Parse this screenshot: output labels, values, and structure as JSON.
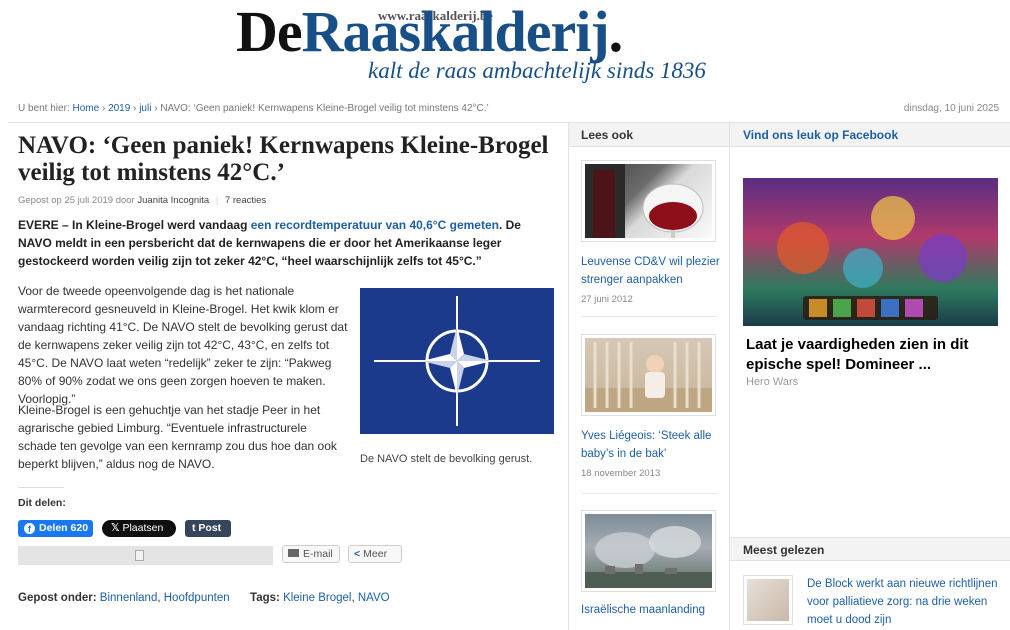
{
  "header": {
    "logo_url": "www.raaskalderij.be",
    "logo_de": "De",
    "logo_name": "Raaskalderij",
    "logo_dot": ".",
    "slogan": "kalt de raas ambachtelijk sinds 1836"
  },
  "breadcrumb": {
    "prefix": "U bent hier:",
    "items": [
      "Home",
      "2019",
      "juli"
    ],
    "current": "NAVO: ‘Geen paniek! Kernwapens Kleine-Brogel veilig tot minstens 42°C.’",
    "date": "dinsdag, 10 juni 2025"
  },
  "article": {
    "title": "NAVO: ‘Geen paniek! Kernwapens Kleine-Brogel veilig tot minstens 42°C.’",
    "posted_prefix": "Gepost op 25 juli 2019 door",
    "author": "Juanita Incognita",
    "comments": "7 reacties",
    "lead_before": "EVERE – In Kleine-Brogel werd vandaag ",
    "lead_link": "een recordtemperatuur van 40,6°C gemeten",
    "lead_after": ". De NAVO meldt in een persbericht dat de kernwapens die er door het Amerikaanse leger gestockeerd worden veilig zijn tot zeker 42°C, “heel waarschijnlijk zelfs tot 45°C.”",
    "para1": "Voor de tweede opeenvolgende dag is het nationale warmterecord gesneuveld in Kleine-Brogel. Het kwik klom er vandaag richting 41°C. De NAVO stelt de bevolking gerust dat de kernwapens zeker veilig zijn tot 42°C, 43°C, en zelfs tot 45°C. De NAVO laat weten “redelijk” zeker te zijn: “Pakweg 80% of 90% zodat we ons geen zorgen hoeven te maken. Voorlopig.”",
    "para2": "Kleine-Brogel is een gehuchtje van het stadje Peer in het agrarische gebied Limburg. “Eventuele infrastructurele schade ten gevolge van een kernramp zou dus hoe dan ook beperkt blijven,” aldus nog de NAVO.",
    "image_caption": "De NAVO stelt de bevolking gerust."
  },
  "share": {
    "label": "Dit delen:",
    "facebook": "Delen 620",
    "x": "Plaatsen",
    "tumblr": "Post",
    "email": "E-mail",
    "more": "Meer"
  },
  "footer_meta": {
    "posted_label": "Gepost onder:",
    "categories": [
      "Binnenland",
      "Hoofdpunten"
    ],
    "tags_label": "Tags:",
    "tags": [
      "Kleine Brogel",
      "NAVO"
    ]
  },
  "lees_ook": {
    "heading": "Lees ook",
    "items": [
      {
        "title": "Leuvense CD&V wil plezier strenger aanpakken",
        "date": "27 juni 2012"
      },
      {
        "title": "Yves Liégeois: ‘Steek alle baby’s in de bak’",
        "date": "18 november 2013"
      },
      {
        "title": "Israëlische maanlanding",
        "date": ""
      }
    ]
  },
  "facebook_col": {
    "heading": "Vind ons leuk op Facebook",
    "ad_title": "Laat je vaardigheden zien in dit epische spel! Domineer ...",
    "ad_source": "Hero Wars"
  },
  "meest_gelezen": {
    "heading": "Meest gelezen",
    "items": [
      {
        "title": "De Block werkt aan nieuwe richtlijnen voor palliatieve zorg: na drie weken moet u dood zijn"
      }
    ]
  },
  "colors": {
    "link": "#1e5fa3",
    "brand_blue": "#174f86",
    "facebook": "#1877f2",
    "nato_blue": "#1b3a8c"
  }
}
